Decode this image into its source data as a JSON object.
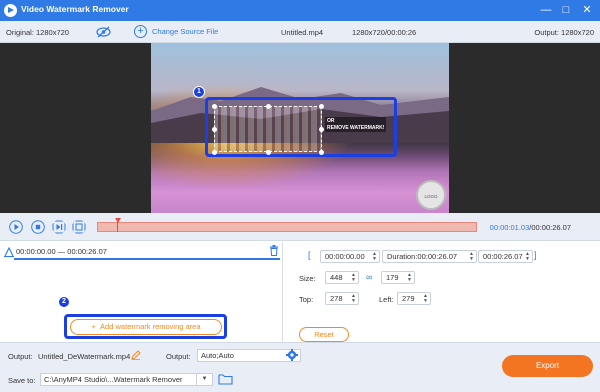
{
  "window": {
    "title": "Video Watermark Remover",
    "controls": [
      "minimize-icon",
      "maximize-icon",
      "close-icon"
    ]
  },
  "infobar": {
    "original": "Original: 1280x720",
    "change_source": "Change Source File",
    "filename": "Untitled.mp4",
    "fileinfo": "1280x720/00:00:26",
    "output": "Output: 1280x720"
  },
  "preview": {
    "watermark_text_line1": "OR",
    "watermark_text_line2": "REMOVE WATERMARK!",
    "badge1": "1",
    "corner_logo": "LOGO"
  },
  "playback": {
    "current_time": "00:00:01.03",
    "total_time": "/00:00:26.07"
  },
  "left_panel": {
    "range": "00:00:00.00 — 00:00:26.07",
    "badge2": "2",
    "add_button": "Add watermark removing area"
  },
  "right_panel": {
    "start": "00:00:00.00",
    "duration": "Duration:00:00:26.07",
    "end": "00:00:26.07",
    "size_label": "Size:",
    "width": "448",
    "height": "179",
    "top_label": "Top:",
    "top": "278",
    "left_label": "Left:",
    "left": "279",
    "reset": "Reset"
  },
  "bottom": {
    "output_label": "Output:",
    "output_file": "Untitled_DeWatermark.mp4",
    "output_label2": "Output:",
    "output_format": "Auto;Auto",
    "save_label": "Save to:",
    "save_path": "C:\\AnyMP4 Studio\\...Watermark Remover",
    "export": "Export"
  },
  "colors": {
    "accent": "#2f7ae5",
    "orange": "#f08a24",
    "export": "#f47521",
    "highlight": "#1b3fe0"
  }
}
